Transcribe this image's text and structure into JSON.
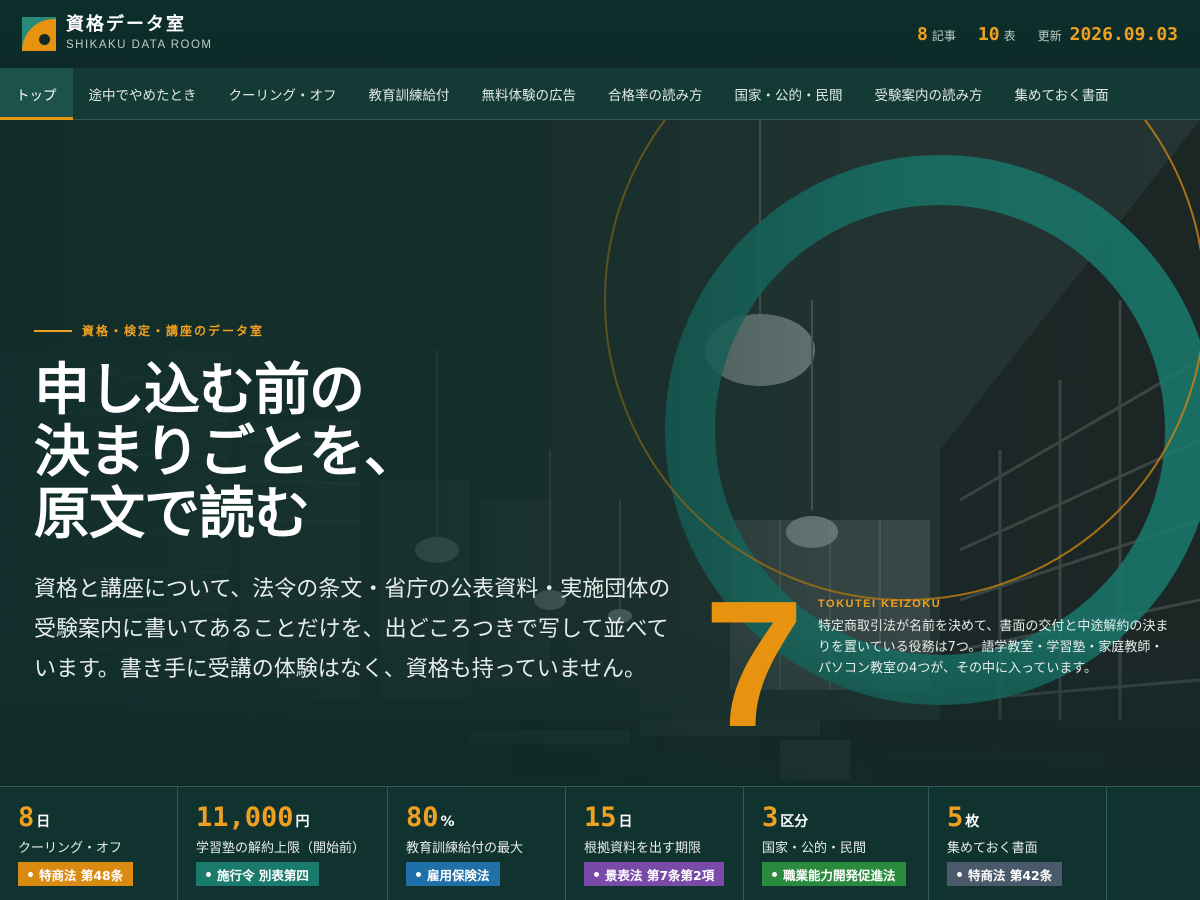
{
  "brand": {
    "title": "資格データ室",
    "subtitle": "SHIKAKU DATA ROOM"
  },
  "header_stats": {
    "articles": {
      "value": "8",
      "unit": "記事"
    },
    "tables": {
      "value": "10",
      "unit": "表"
    },
    "updated": {
      "label": "更新",
      "value": "2026.09.03"
    }
  },
  "nav": {
    "items": [
      {
        "label": "トップ",
        "active": true
      },
      {
        "label": "途中でやめたとき"
      },
      {
        "label": "クーリング・オフ"
      },
      {
        "label": "教育訓練給付"
      },
      {
        "label": "無料体験の広告"
      },
      {
        "label": "合格率の読み方"
      },
      {
        "label": "国家・公的・民間"
      },
      {
        "label": "受験案内の読み方"
      },
      {
        "label": "集めておく書面"
      }
    ]
  },
  "hero": {
    "eyebrow": "資格・検定・講座のデータ室",
    "title_lines": [
      "申し込む前の",
      "決まりごとを、",
      "原文で読む"
    ],
    "lead": "資格と講座について、法令の条文・省庁の公表資料・実施団体の受験案内に書いてあることだけを、出どころつきで写して並べています。書き手に受講の体験はなく、資格も持っていません。",
    "feature": {
      "number": "7",
      "label_en": "TOKUTEI KEIZOKU",
      "text": "特定商取引法が名前を決めて、書面の交付と中途解約の決まりを置いている役務は7つ。語学教室・学習塾・家庭教師・パソコン教室の4つが、その中に入っています。"
    }
  },
  "stat_cells": [
    {
      "value": "8",
      "unit": "日",
      "label": "クーリング・オフ",
      "tag": "特商法 第48条",
      "tag_color": "#d98a10"
    },
    {
      "value": "11,000",
      "unit": "円",
      "label": "学習塾の解約上限（開始前）",
      "tag": "施行令 別表第四",
      "tag_color": "#1a7a6c"
    },
    {
      "value": "80",
      "unit": "%",
      "label": "教育訓練給付の最大",
      "tag": "雇用保険法",
      "tag_color": "#1f6fa8"
    },
    {
      "value": "15",
      "unit": "日",
      "label": "根拠資料を出す期限",
      "tag": "景表法 第7条第2項",
      "tag_color": "#7a4aa8"
    },
    {
      "value": "3",
      "unit": "区分",
      "label": "国家・公的・民間",
      "tag": "職業能力開発促進法",
      "tag_color": "#2a8a3e"
    },
    {
      "value": "5",
      "unit": "枚",
      "label": "集めておく書面",
      "tag": "特商法 第42条",
      "tag_color": "#4a5a6a"
    }
  ],
  "colors": {
    "accent": "#f0a020",
    "brand_green": "#0f2a28",
    "teal_ring": "#1a7f72"
  }
}
